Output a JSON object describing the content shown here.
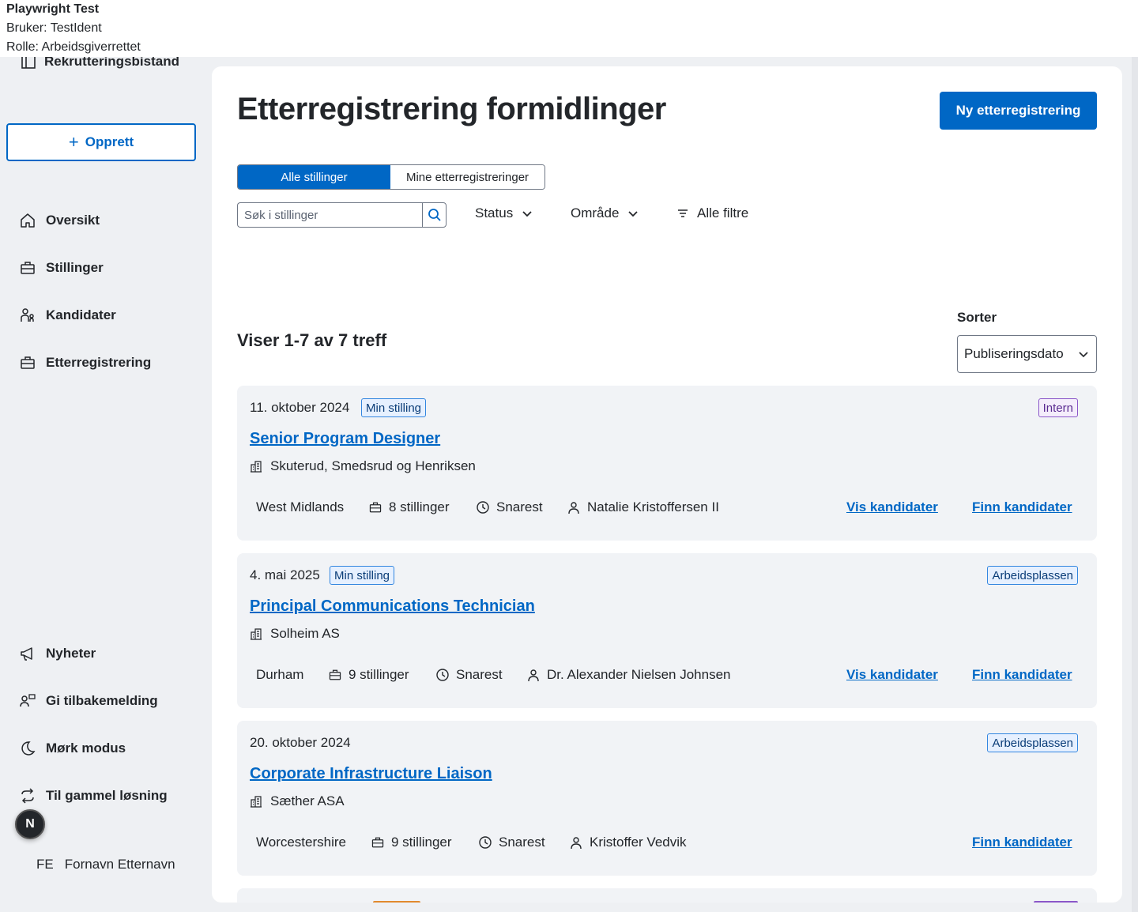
{
  "testbar": {
    "title": "Playwright Test",
    "user": "Bruker: TestIdent",
    "role": "Rolle: Arbeidsgiverrettet"
  },
  "sidebar": {
    "brand": "Rekrutteringsbistand",
    "create_label": "Opprett",
    "nav": [
      {
        "label": "Oversikt",
        "icon": "house-icon"
      },
      {
        "label": "Stillinger",
        "icon": "briefcase-icon"
      },
      {
        "label": "Kandidater",
        "icon": "people-icon"
      },
      {
        "label": "Etterregistrering",
        "icon": "briefcase-icon"
      }
    ],
    "bottom_nav": [
      {
        "label": "Nyheter",
        "icon": "megaphone-icon"
      },
      {
        "label": "Gi tilbakemelding",
        "icon": "feedback-icon"
      },
      {
        "label": "Mørk modus",
        "icon": "moon-icon"
      },
      {
        "label": "Til gammel løsning",
        "icon": "arrows-cycle-icon"
      }
    ],
    "avatar_letter": "N",
    "user_initials": "FE",
    "user_name": "Fornavn Etternavn"
  },
  "main": {
    "title": "Etterregistrering formidlinger",
    "new_button": "Ny etterregistrering",
    "toggle": {
      "active": "Alle stillinger",
      "inactive": "Mine etterregistreringer"
    },
    "search_placeholder": "Søk i stillinger",
    "filters": {
      "status": "Status",
      "area": "Område",
      "all": "Alle filtre"
    },
    "results": "Viser 1-7 av 7 treff",
    "sort_label": "Sorter",
    "sort_value": "Publiseringsdato"
  },
  "cards": [
    {
      "date": "11. oktober 2024",
      "badge": "Min stilling",
      "source": "Intern",
      "title": "Senior Program Designer",
      "employer": "Skuterud, Smedsrud og Henriksen",
      "location": "West Midlands",
      "positions": "8 stillinger",
      "deadline": "Snarest",
      "owner": "Natalie Kristoffersen II",
      "view_label": "Vis kandidater",
      "find_label": "Finn kandidater"
    },
    {
      "date": "4. mai 2025",
      "badge": "Min stilling",
      "source": "Arbeidsplassen",
      "title": "Principal Communications Technician",
      "employer": "Solheim AS",
      "location": "Durham",
      "positions": "9 stillinger",
      "deadline": "Snarest",
      "owner": "Dr. Alexander Nielsen Johnsen",
      "view_label": "Vis kandidater",
      "find_label": "Finn kandidater"
    },
    {
      "date": "20. oktober 2024",
      "source": "Arbeidsplassen",
      "title": "Corporate Infrastructure Liaison",
      "employer": "Sæther ASA",
      "location": "Worcestershire",
      "positions": "9 stillinger",
      "deadline": "Snarest",
      "owner": "Kristoffer Vedvik",
      "find_label": "Finn kandidater"
    }
  ]
}
